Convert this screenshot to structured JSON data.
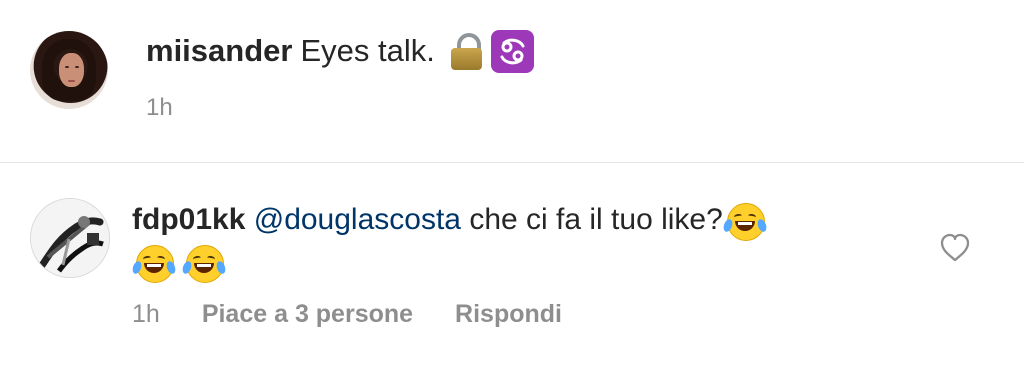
{
  "caption": {
    "username": "miisander",
    "text": "Eyes talk.",
    "emojis": [
      "lock-icon",
      "cancer-zodiac-icon"
    ],
    "time": "1h"
  },
  "comment": {
    "username": "fdp01kk",
    "mention": "@douglascosta",
    "text": "che ci fa il tuo like?",
    "emojis": [
      "face-with-tears-of-joy-icon",
      "face-with-tears-of-joy-icon",
      "face-with-tears-of-joy-icon"
    ],
    "time": "1h",
    "likes_label": "Piace a 3 persone",
    "reply_label": "Rispondi"
  },
  "colors": {
    "text": "#262626",
    "muted": "#8e8e8e",
    "mention": "#003569",
    "divider": "#e5e5e5",
    "cancer_bg": "#9d38b8"
  }
}
